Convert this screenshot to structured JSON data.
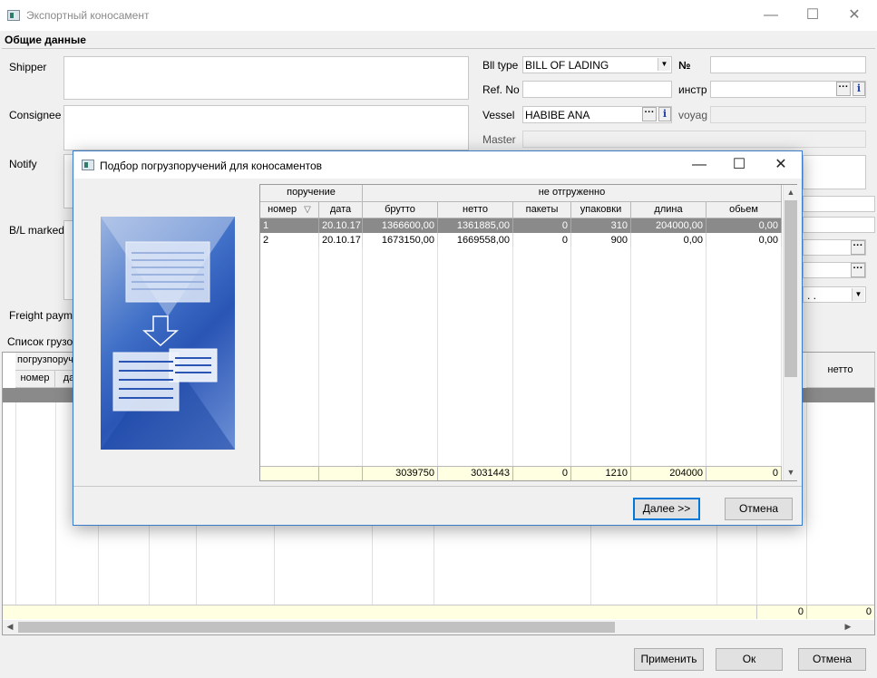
{
  "window": {
    "title": "Экспортный коносамент",
    "minimize": "—",
    "maximize": "☐",
    "close": "✕"
  },
  "general": {
    "section_title": "Общие данные",
    "shipper_label": "Shipper",
    "consignee_label": "Consignee",
    "notify_label": "Notify",
    "bl_marked_label": "B/L marked",
    "freight_payment_label": "Freight paymer",
    "bl_type_label": "Bll type",
    "bl_type_value": "BILL OF LADING",
    "number_label": "№",
    "ref_no_label": "Ref. No",
    "instr_label": "инстр",
    "vessel_label": "Vessel",
    "vessel_value": "HABIBE ANA",
    "voyage_label": "voyag",
    "master_label": "Master",
    "combo_partial_value": ". ."
  },
  "cargo_list": {
    "title": "Список грузо",
    "header_group": "погрузпоруч",
    "col_nomer": "номер",
    "col_data": "да",
    "col_netto": "нетто",
    "total_1": "0",
    "total_2": "0"
  },
  "bottom_buttons": {
    "apply": "Применить",
    "ok": "Ок",
    "cancel": "Отмена"
  },
  "dialog": {
    "title": "Подбор погрузпоручений для коносаментов",
    "minimize": "—",
    "maximize": "☐",
    "close": "✕",
    "group_order": "поручение",
    "group_not_shipped": "не отгруженно",
    "columns": {
      "nomer": "номер",
      "sort_icon": "▽",
      "data": "дата",
      "brutto": "брутто",
      "netto": "нетто",
      "pakety": "пакеты",
      "upakovki": "упаковки",
      "dlina": "длина",
      "obem": "обьем"
    },
    "rows": [
      {
        "nomer": "1",
        "data": "20.10.17",
        "brutto": "1366600,00",
        "netto": "1361885,00",
        "pakety": "0",
        "upakovki": "310",
        "dlina": "204000,00",
        "obem": "0,00"
      },
      {
        "nomer": "2",
        "data": "20.10.17",
        "brutto": "1673150,00",
        "netto": "1669558,00",
        "pakety": "0",
        "upakovki": "900",
        "dlina": "0,00",
        "obem": "0,00"
      }
    ],
    "totals": {
      "brutto": "3039750",
      "netto": "3031443",
      "pakety": "0",
      "upakovki": "1210",
      "dlina": "204000",
      "obem": "0"
    },
    "next_button": "Далее >>",
    "cancel_button": "Отмена"
  }
}
